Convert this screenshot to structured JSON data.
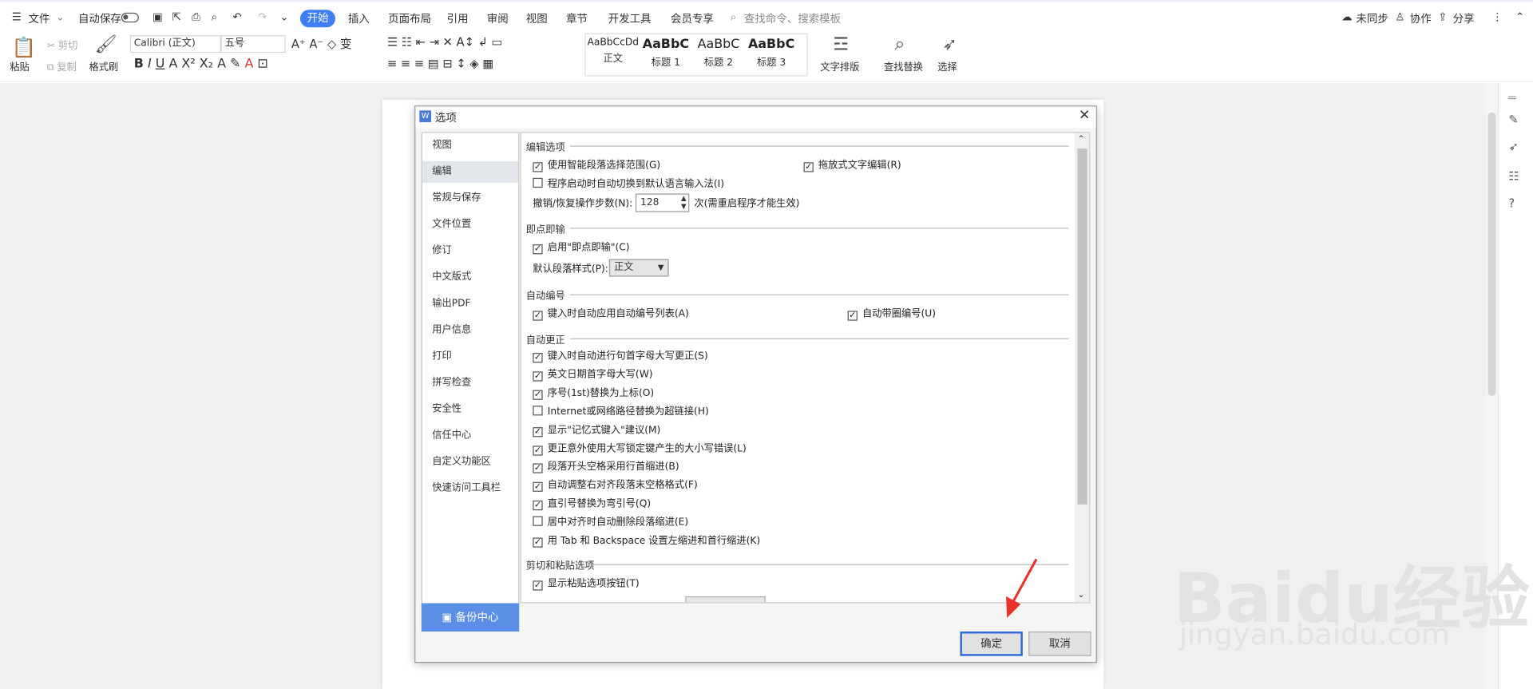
{
  "topbar": {
    "file": "文件",
    "autosave": "自动保存",
    "tabs": [
      "开始",
      "插入",
      "页面布局",
      "引用",
      "审阅",
      "视图",
      "章节",
      "开发工具",
      "会员专享"
    ],
    "search_placeholder": "查找命令、搜索模板",
    "sync": "未同步",
    "collab": "协作",
    "share": "分享"
  },
  "ribbon": {
    "paste": "粘贴",
    "cut": "剪切",
    "copy": "复制",
    "format_painter": "格式刷",
    "font_name": "Calibri (正文)",
    "font_size": "五号",
    "styles": [
      {
        "preview": "AaBbCcDd",
        "label": "正文"
      },
      {
        "preview": "AaBbC",
        "label": "标题 1"
      },
      {
        "preview": "AaBbC",
        "label": "标题 2"
      },
      {
        "preview": "AaBbC",
        "label": "标题 3"
      }
    ],
    "text_layout": "文字排版",
    "find_replace": "查找替换",
    "select": "选择"
  },
  "dialog": {
    "title": "选项",
    "nav": [
      "视图",
      "编辑",
      "常规与保存",
      "文件位置",
      "修订",
      "中文版式",
      "输出PDF",
      "用户信息",
      "打印",
      "拼写检查",
      "安全性",
      "信任中心",
      "自定义功能区",
      "快速访问工具栏"
    ],
    "selected_nav": "编辑",
    "backup": "备份中心",
    "ok": "确定",
    "cancel": "取消",
    "sections": {
      "edit": "编辑选项",
      "instant": "即点即输",
      "autonum": "自动编号",
      "autocorrect": "自动更正",
      "cutpaste": "剪切和粘贴选项"
    },
    "edit_options": {
      "smart_para": "使用智能段落选择范围(G)",
      "drag_edit": "拖放式文字编辑(R)",
      "auto_ime": "程序启动时自动切换到默认语言输入法(I)",
      "undo_label": "撤销/恢复操作步数(N):",
      "undo_value": "128",
      "undo_note": "次(需重启程序才能生效)"
    },
    "instant": {
      "enable": "启用\"即点即输\"(C)",
      "default_style_label": "默认段落样式(P):",
      "default_style_value": "正文"
    },
    "autonum": {
      "apply_list": "键入时自动应用自动编号列表(A)",
      "circle_num": "自动带圈编号(U)"
    },
    "autocorrect_items": [
      {
        "label": "键入时自动进行句首字母大写更正(S)",
        "checked": true
      },
      {
        "label": "英文日期首字母大写(W)",
        "checked": true
      },
      {
        "label": "序号(1st)替换为上标(O)",
        "checked": true
      },
      {
        "label": "Internet或网络路径替换为超链接(H)",
        "checked": false
      },
      {
        "label": "显示\"记忆式键入\"建议(M)",
        "checked": true
      },
      {
        "label": "更正意外使用大写锁定键产生的大小写错误(L)",
        "checked": true
      },
      {
        "label": "段落开头空格采用行首缩进(B)",
        "checked": true
      },
      {
        "label": "自动调整右对齐段落末空格格式(F)",
        "checked": true
      },
      {
        "label": "直引号替换为弯引号(Q)",
        "checked": true
      },
      {
        "label": "居中对齐时自动删除段落缩进(E)",
        "checked": false
      },
      {
        "label": "用 Tab 和 Backspace 设置左缩进和首行缩进(K)",
        "checked": true
      }
    ],
    "cutpaste": {
      "show_btn": "显示粘贴选项按钮(T)"
    }
  },
  "watermark": {
    "brand": "Baidu经验",
    "url": "jingyan.baidu.com"
  },
  "colors": {
    "accent": "#3f7ef6",
    "backup": "#5b8ee6",
    "arrow": "#e8322a"
  }
}
